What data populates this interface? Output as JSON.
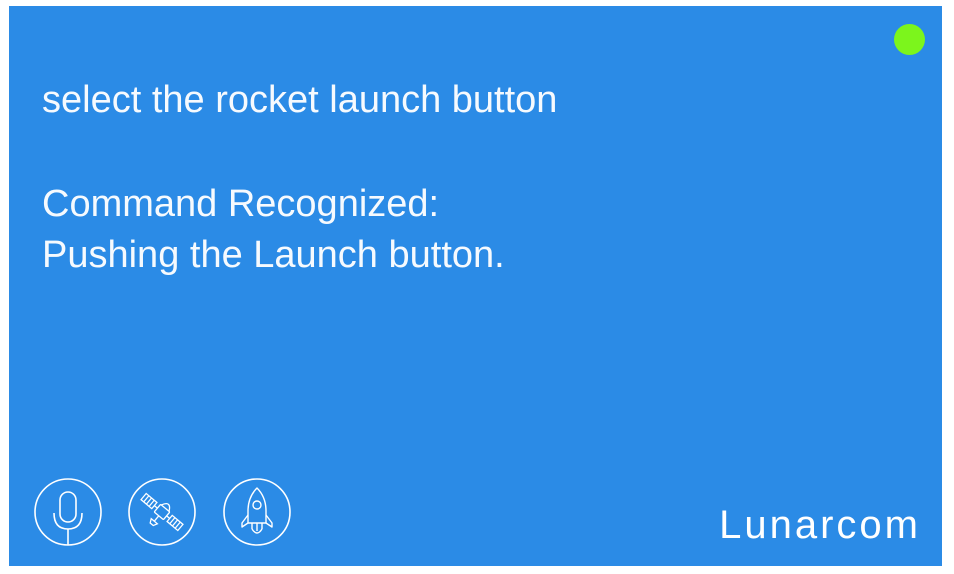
{
  "app": {
    "brand": "Lunarcom",
    "status_color": "#7cf51c",
    "accent_color": "#2b8be6"
  },
  "transcript": {
    "query": "select the rocket launch button",
    "recognized_label": "Command Recognized:",
    "action": "Pushing the Launch button."
  },
  "toolbar": {
    "buttons": [
      {
        "name": "microphone",
        "icon": "microphone-icon"
      },
      {
        "name": "satellite",
        "icon": "satellite-icon"
      },
      {
        "name": "rocket",
        "icon": "rocket-icon"
      }
    ]
  }
}
